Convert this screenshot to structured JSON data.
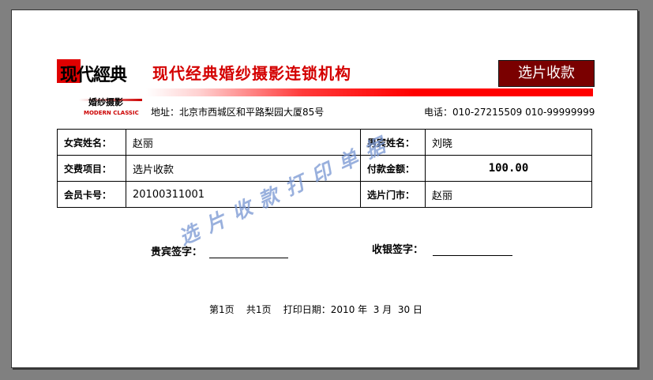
{
  "header": {
    "logo_text": "现代經典",
    "logo_subtitle": "婚纱摄影",
    "logo_english": "MODERN CLASSIC",
    "company_name": "现代经典婚纱摄影连锁机构",
    "badge": "选片收款",
    "address": "地址：北京市西城区和平路梨园大厦85号",
    "phone": "电话：010-27215509 010-99999999"
  },
  "details": {
    "bride_label": "女宾姓名：",
    "bride_value": "赵丽",
    "groom_label": "男宾姓名：",
    "groom_value": "刘晓",
    "item_label": "交费项目：",
    "item_value": "选片收款",
    "amount_label": "付款金额：",
    "amount_value": "100.00",
    "card_label": "会员卡号：",
    "card_value": "20100311001",
    "store_label": "选片门市：",
    "store_value": "赵丽"
  },
  "signatures": {
    "guest_label": "贵宾签字：",
    "cashier_label": "收银签字："
  },
  "footer": {
    "text": "第1页    共1页    打印日期：2010 年  3 月  30 日"
  },
  "watermark": "选片收款打印单据",
  "colors": {
    "brand_red": "#d40000",
    "badge_bg": "#7a0000",
    "watermark": "#7896d2",
    "viewer_bg": "#808080"
  }
}
